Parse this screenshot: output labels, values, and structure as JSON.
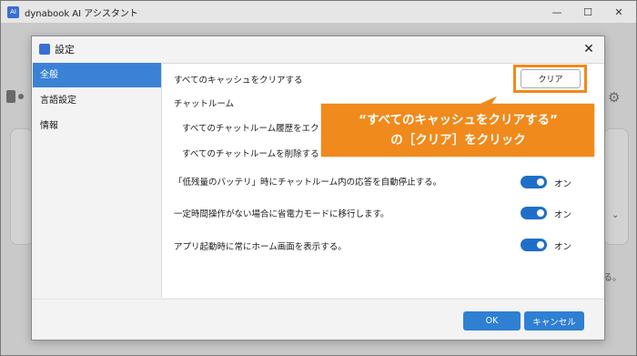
{
  "app": {
    "title": "dynabook AI アシスタント",
    "logo_text": "AI",
    "controls": {
      "minimize": "—",
      "maximize": "☐",
      "close": "✕"
    },
    "partial_text": "る。"
  },
  "dialog": {
    "title": "設定",
    "close_glyph": "✕",
    "sidebar": [
      {
        "label": "全般",
        "active": true
      },
      {
        "label": "言語設定",
        "active": false
      },
      {
        "label": "情報",
        "active": false
      }
    ],
    "content": {
      "clear_cache_label": "すべてのキャッシュをクリアする",
      "clear_button": "クリア",
      "chat_room_heading": "チャットルーム",
      "export_history_label": "すべてのチャットルーム履歴をエクスポートす",
      "delete_rooms_label": "すべてのチャットルームを削除する",
      "settings": [
        {
          "label": "「低残量のバッテリ」時にチャットルーム内の応答を自動停止する。",
          "state": "オン",
          "on": true
        },
        {
          "label": "一定時間操作がない場合に省電力モードに移行します。",
          "state": "オン",
          "on": true
        },
        {
          "label": "アプリ起動時に常にホーム画面を表示する。",
          "state": "オン",
          "on": true
        }
      ]
    },
    "footer": {
      "ok": "OK",
      "cancel": "キャンセル"
    }
  },
  "annotation": {
    "line1": "“すべてのキャッシュをクリアする”",
    "line2": "の［クリア］をクリック",
    "color": "#f08a1c"
  }
}
